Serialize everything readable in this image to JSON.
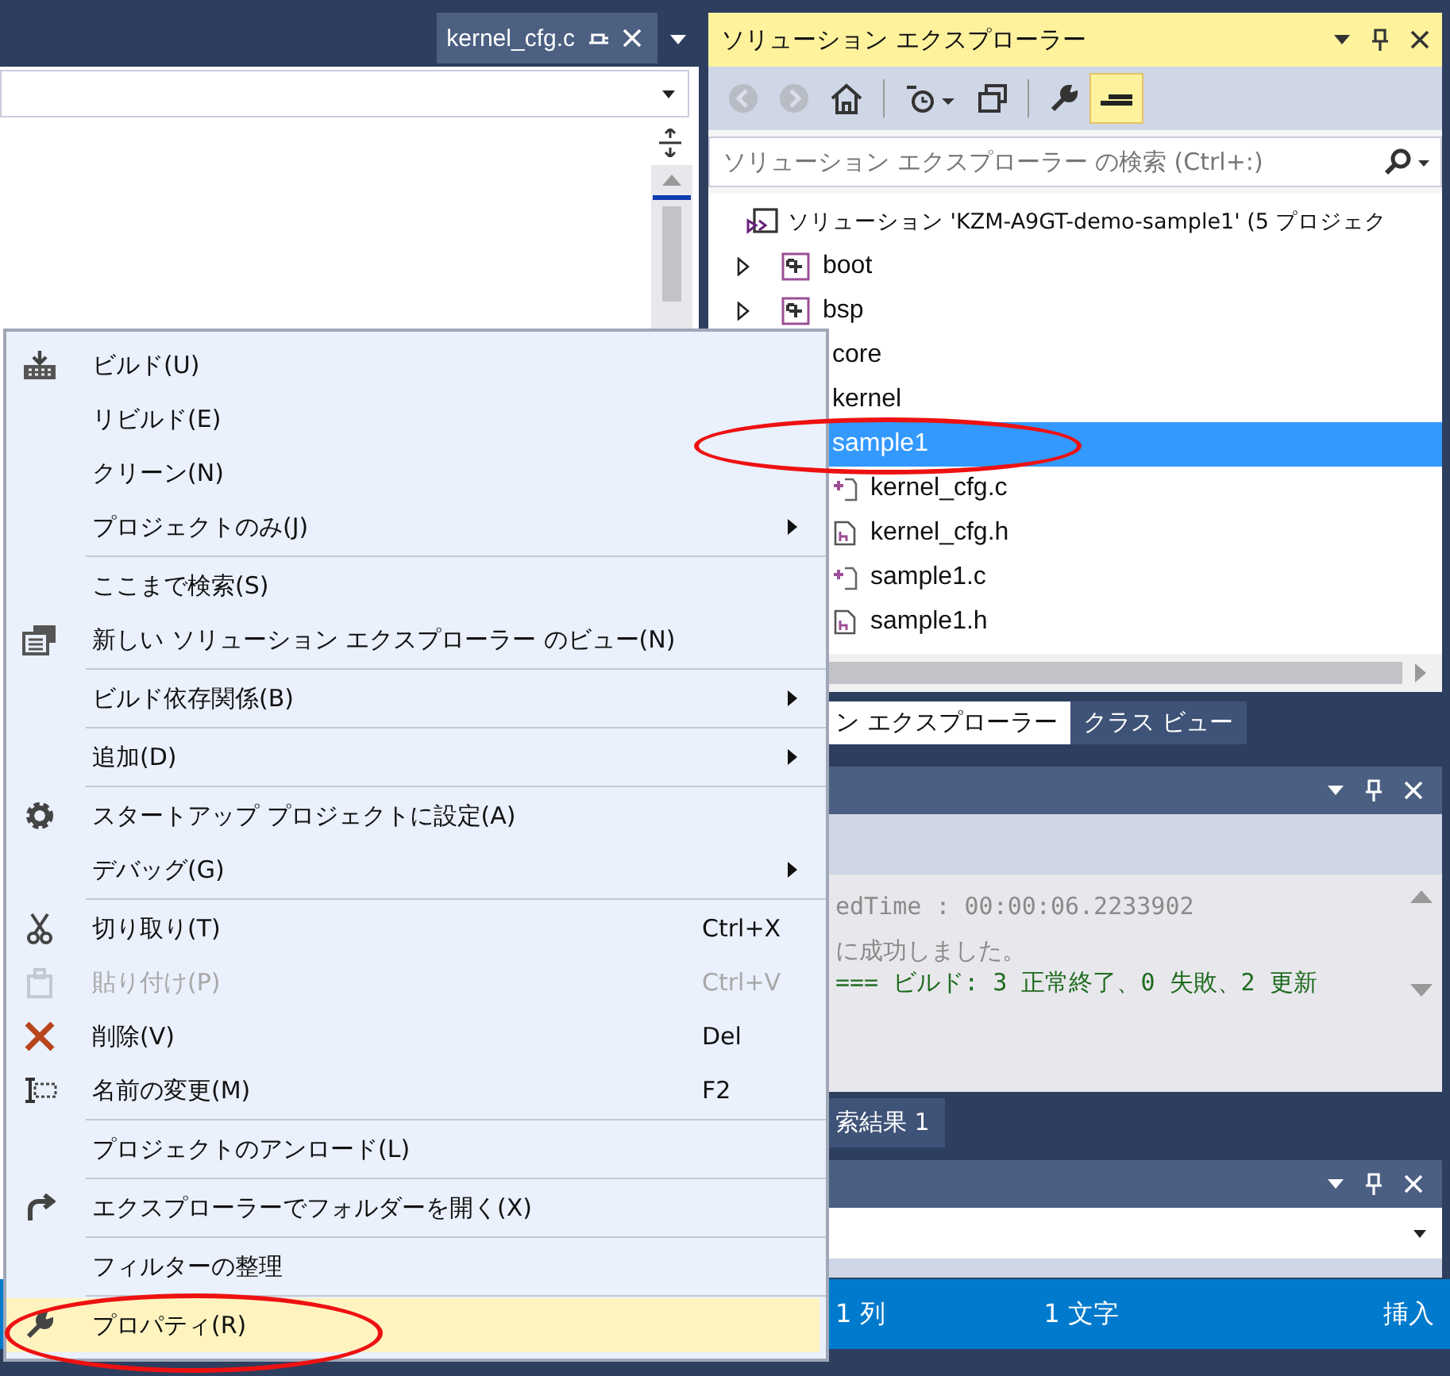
{
  "document_tab": {
    "title": "kernel_cfg.c"
  },
  "solution_explorer": {
    "title": "ソリューション エクスプローラー",
    "search": {
      "placeholder": "ソリューション エクスプローラー の検索 (Ctrl+:)"
    },
    "tree": [
      {
        "label": "ソリューション 'KZM-A9GT-demo-sample1' (5 プロジェク",
        "kind": "solution",
        "selected": false
      },
      {
        "label": "boot",
        "kind": "project",
        "selected": false
      },
      {
        "label": "bsp",
        "kind": "project",
        "selected": false
      },
      {
        "label": "core",
        "kind": "label",
        "selected": false
      },
      {
        "label": "kernel",
        "kind": "label",
        "selected": false
      },
      {
        "label": "sample1",
        "kind": "label",
        "selected": true,
        "children": [
          {
            "label": "kernel_cfg.c",
            "kind": "c-file",
            "selected": false
          },
          {
            "label": "kernel_cfg.h",
            "kind": "h-file",
            "selected": false
          },
          {
            "label": "sample1.c",
            "kind": "c-file",
            "selected": false
          },
          {
            "label": "sample1.h",
            "kind": "h-file",
            "selected": false
          }
        ]
      }
    ]
  },
  "panel_tabs": [
    {
      "label": "ン エクスプローラー",
      "selected": true
    },
    {
      "label": "クラス ビュー",
      "selected": false
    }
  ],
  "output": {
    "lines": [
      {
        "text": "edTime : 00:00:06.2233902",
        "kind": "info"
      },
      {
        "text": "に成功しました。",
        "kind": "info"
      },
      {
        "text": "=== ビルド: 3 正常終了、0 失敗、2 更新",
        "kind": "summary"
      }
    ]
  },
  "find_tab": {
    "label": "索結果 1"
  },
  "status_bar": [
    "1 列",
    "1 文字",
    "挿入"
  ],
  "context_menu": [
    [
      {
        "label": "ビルド(U)",
        "kind": "build"
      },
      {
        "label": "リビルド(E)",
        "kind": "plain"
      },
      {
        "label": "クリーン(N)",
        "kind": "plain"
      },
      {
        "label": "プロジェクトのみ(J)",
        "kind": "plain",
        "submenu": true
      }
    ],
    [
      {
        "label": "ここまで検索(S)",
        "kind": "plain"
      },
      {
        "label": "新しい ソリューション エクスプローラー のビュー(N)",
        "kind": "new-view"
      }
    ],
    [
      {
        "label": "ビルド依存関係(B)",
        "kind": "plain",
        "submenu": true
      }
    ],
    [
      {
        "label": "追加(D)",
        "kind": "plain",
        "submenu": true
      }
    ],
    [
      {
        "label": "スタートアップ プロジェクトに設定(A)",
        "kind": "startup"
      },
      {
        "label": "デバッグ(G)",
        "kind": "plain",
        "submenu": true
      }
    ],
    [
      {
        "label": "切り取り(T)",
        "kind": "cut",
        "shortcut": "Ctrl+X"
      },
      {
        "label": "貼り付け(P)",
        "kind": "paste",
        "shortcut": "Ctrl+V",
        "disabled": true
      },
      {
        "label": "削除(V)",
        "kind": "delete",
        "shortcut": "Del"
      },
      {
        "label": "名前の変更(M)",
        "kind": "rename",
        "shortcut": "F2"
      }
    ],
    [
      {
        "label": "プロジェクトのアンロード(L)",
        "kind": "plain"
      }
    ],
    [
      {
        "label": "エクスプローラーでフォルダーを開く(X)",
        "kind": "open-folder"
      }
    ],
    [
      {
        "label": "フィルターの整理",
        "kind": "plain"
      }
    ],
    [
      {
        "label": "プロパティ(R)",
        "kind": "properties",
        "selected": true
      }
    ]
  ]
}
